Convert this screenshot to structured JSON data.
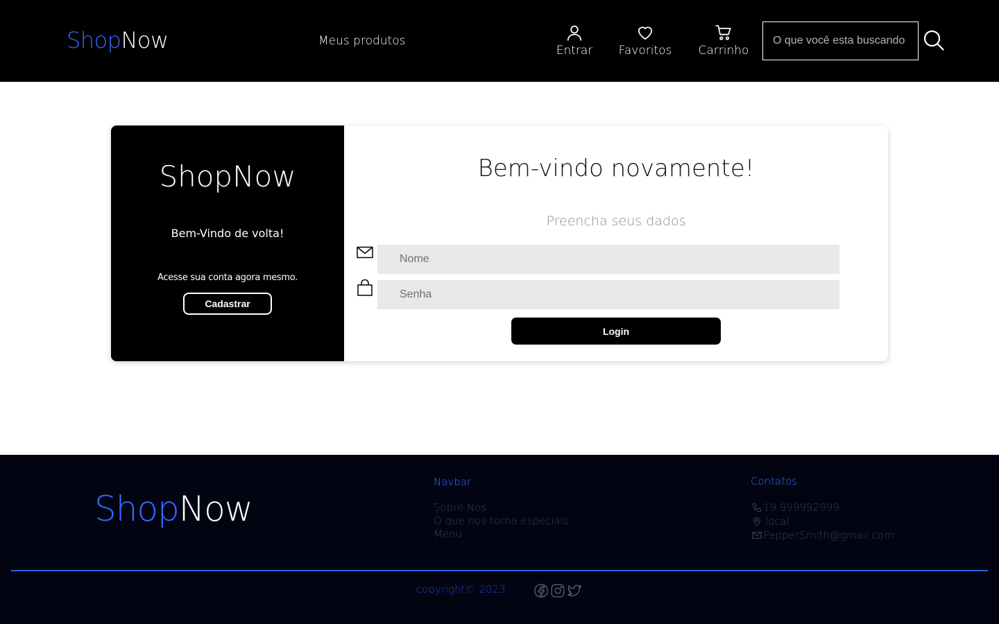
{
  "header": {
    "logo_part1": "Shop",
    "logo_part2": "Now",
    "nav_link": "Meus produtos",
    "login_label": "Entrar",
    "favorites_label": "Favoritos",
    "cart_label": "Carrinho",
    "search_placeholder": "O que você esta buscando",
    "icons": {
      "login": "user-icon",
      "favorites": "heart-icon",
      "cart": "cart-icon",
      "search": "search-icon"
    }
  },
  "welcome_panel": {
    "title": "ShopNow",
    "subtitle": "Bem-Vindo de volta!",
    "text": "Acesse sua conta agora mesmo.",
    "register_button": "Cadastrar"
  },
  "login_form": {
    "title": "Bem-vindo novamente!",
    "subtitle": "Preencha seus dados",
    "name_placeholder": "Nome",
    "password_placeholder": "Senha",
    "submit_button": "Login",
    "icons": {
      "name": "mail-icon",
      "password": "lock-icon"
    }
  },
  "footer": {
    "logo_part1": "Shop",
    "logo_part2": "Now",
    "nav_title": "Navbar",
    "nav_items": [
      "Sobre Nos",
      "O que nos torna especiais",
      "Menu"
    ],
    "contacts_title": "Contatos",
    "phone": "19 999992999",
    "location": "local",
    "email": "PepperSmith@gmail.com",
    "copyright": "copyright© 2023",
    "social_icons": [
      "facebook-icon",
      "instagram-icon",
      "twitter-icon"
    ]
  },
  "colors": {
    "brand_blue": "#2f6bff",
    "header_bg": "#000000",
    "footer_bg": "#030412",
    "divider": "#2568d8"
  }
}
